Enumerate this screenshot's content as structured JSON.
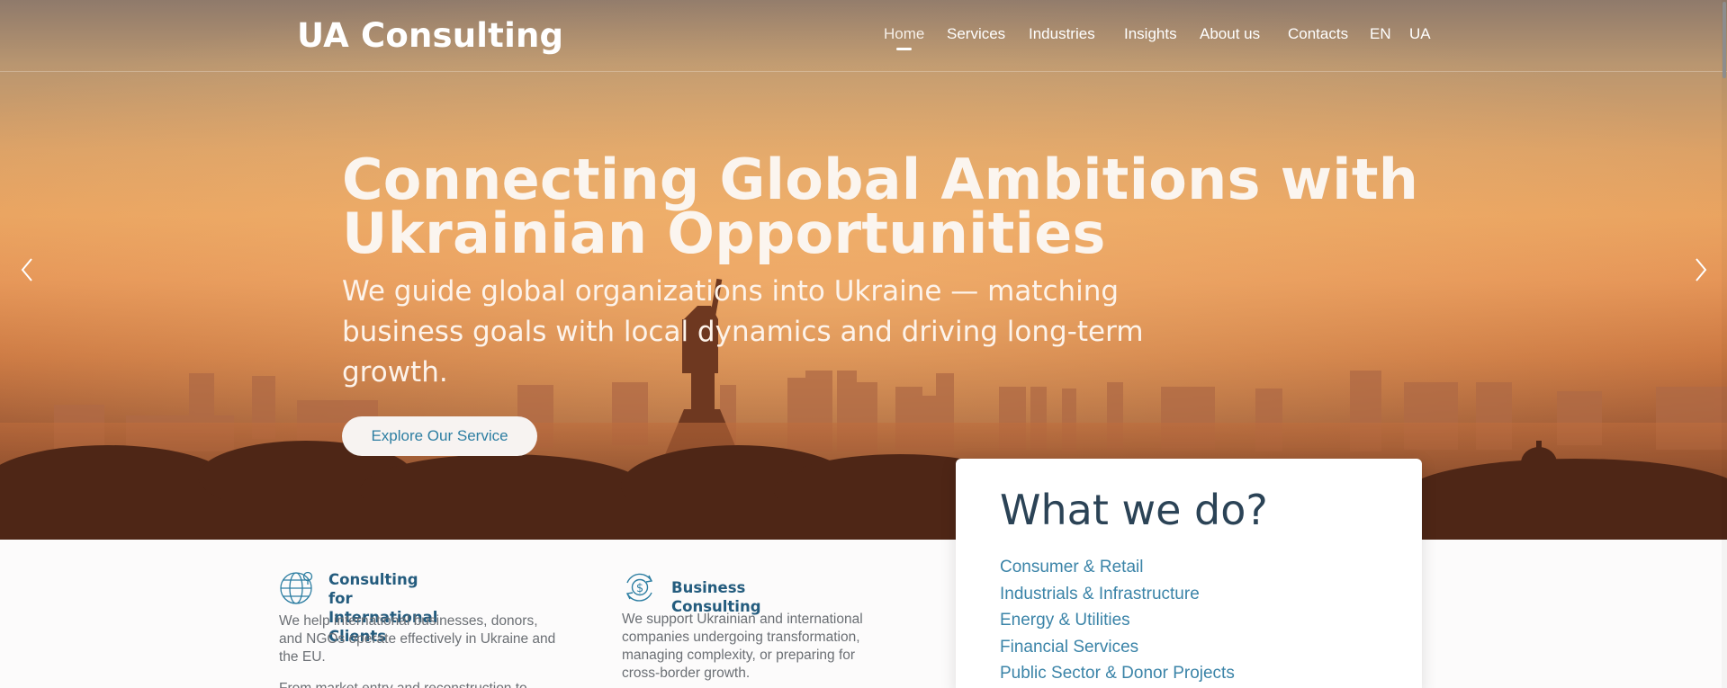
{
  "header": {
    "logo": "UA Consulting",
    "nav": [
      "Home",
      "Services",
      "Industries",
      "Insights",
      "About us",
      "Contacts",
      "EN",
      "UA"
    ],
    "active": "Home"
  },
  "hero": {
    "title_line1": "Connecting Global Ambitions with",
    "title_line2": "Ukrainian Opportunities",
    "subtitle_line1": "We guide global organizations into Ukraine — matching",
    "subtitle_line2": "business goals with local dynamics and driving long-term",
    "subtitle_line3": "growth.",
    "cta_label": "Explore Our Service",
    "prev_icon": "chevron-left-icon",
    "next_icon": "chevron-right-icon"
  },
  "services": [
    {
      "icon": "globe-icon",
      "title_line1": "Consulting for International",
      "title_line2": "Clients",
      "desc_line1": "We help international businesses, donors,",
      "desc_line2": "and NGOs operate effectively in Ukraine and",
      "desc_line3": "the EU.",
      "more": "From market entry and reconstruction to"
    },
    {
      "icon": "dollar-cycle-icon",
      "title_line1": "Business Consulting",
      "desc_line1": "We support Ukrainian and international",
      "desc_line2": "companies undergoing transformation,",
      "desc_line3": "managing complexity, or preparing for",
      "desc_line4": "cross-border growth."
    }
  ],
  "what_we_do": {
    "heading": "What we do?",
    "items": [
      "Consumer & Retail",
      "Industrials & Infrastructure",
      "Energy & Utilities",
      "Financial Services",
      "Public Sector & Donor Projects"
    ]
  },
  "colors": {
    "accent": "#3b84a8",
    "heading_dark": "#2b4356",
    "service_title": "#245c7e"
  }
}
